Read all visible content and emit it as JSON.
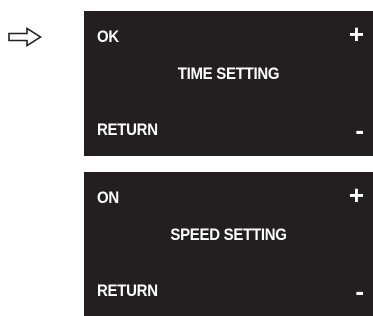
{
  "indicator": {
    "icon": "right-arrow-icon"
  },
  "panels": [
    {
      "top_label": "OK",
      "title": "TIME SETTING",
      "bottom_label": "RETURN",
      "plus_label": "+",
      "minus_label": "-"
    },
    {
      "top_label": "ON",
      "title": "SPEED SETTING",
      "bottom_label": "RETURN",
      "plus_label": "+",
      "minus_label": "-"
    }
  ],
  "colors": {
    "panel_bg": "#231f20",
    "text": "#ffffff"
  }
}
